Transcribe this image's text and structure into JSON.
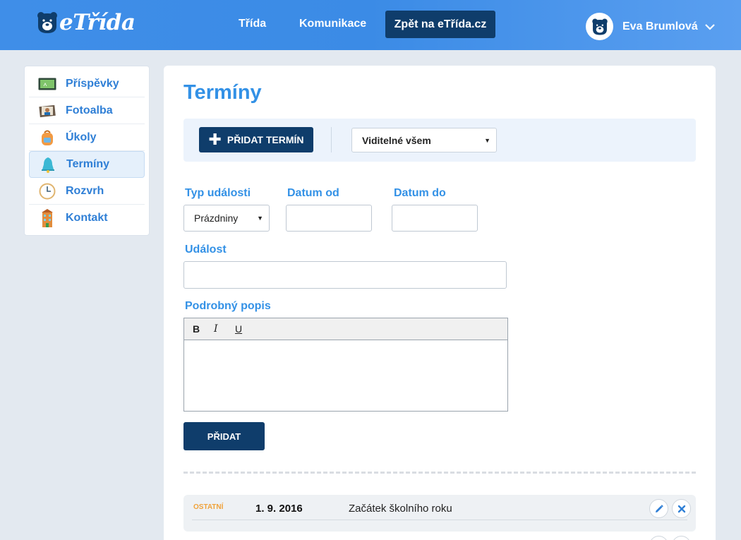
{
  "header": {
    "logo_text": "eTřída",
    "nav": [
      {
        "label": "Třída"
      },
      {
        "label": "Komunikace"
      }
    ],
    "back_button": "Zpět na eTřída.cz",
    "user_name": "Eva Brumlová"
  },
  "sidebar": {
    "items": [
      {
        "label": "Příspěvky",
        "icon": "board-icon"
      },
      {
        "label": "Fotoalba",
        "icon": "photo-album-icon"
      },
      {
        "label": "Úkoly",
        "icon": "backpack-icon"
      },
      {
        "label": "Termíny",
        "icon": "bell-icon",
        "active": true
      },
      {
        "label": "Rozvrh",
        "icon": "clock-icon"
      },
      {
        "label": "Kontakt",
        "icon": "building-icon"
      }
    ]
  },
  "main": {
    "title": "Termíny",
    "add_term_button": "PŘIDAT TERMÍN",
    "visibility_select": "Viditelné všem",
    "form": {
      "type_label": "Typ události",
      "type_value": "Prázdniny",
      "date_from_label": "Datum od",
      "date_from_value": "",
      "date_to_label": "Datum do",
      "date_to_value": "",
      "event_label": "Událost",
      "event_value": "",
      "description_label": "Podrobný popis",
      "editor_buttons": [
        "B",
        "I",
        "U"
      ],
      "submit_button": "PŘIDAT"
    },
    "events": [
      {
        "category": "OSTATNÍ",
        "date": "1. 9. 2016",
        "title": "Začátek školního roku"
      }
    ]
  },
  "colors": {
    "accent": "#3391e6",
    "header": "#3b8be6",
    "dark_button": "#0f3d6b",
    "category": "#f0a23a"
  }
}
